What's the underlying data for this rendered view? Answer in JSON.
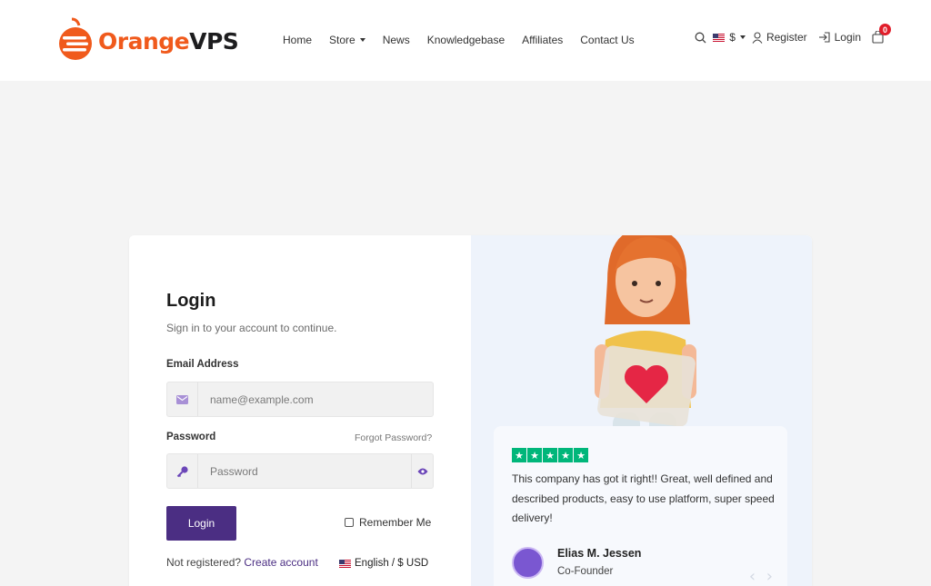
{
  "brand": {
    "name_orange": "Orange",
    "name_dark": "VPS",
    "accent": "#f05a1c",
    "primary": "#4b2e83"
  },
  "nav": {
    "items": [
      {
        "label": "Home"
      },
      {
        "label": "Store"
      },
      {
        "label": "News"
      },
      {
        "label": "Knowledgebase"
      },
      {
        "label": "Affiliates"
      },
      {
        "label": "Contact Us"
      }
    ]
  },
  "header_right": {
    "currency": "$",
    "register": "Register",
    "login": "Login",
    "cart_count": "0"
  },
  "login_form": {
    "title": "Login",
    "subtitle": "Sign in to your account to continue.",
    "email_label": "Email Address",
    "email_placeholder": "name@example.com",
    "password_label": "Password",
    "password_placeholder": "Password",
    "forgot": "Forgot Password?",
    "submit": "Login",
    "remember": "Remember Me",
    "not_registered": "Not registered?",
    "create_account": "Create account",
    "language": "English / $ USD"
  },
  "testimonial": {
    "rating": 5,
    "quote": "This company has got it right!! Great, well defined and described products, easy to use platform, super speed delivery!",
    "name": "Elias M. Jessen",
    "role": "Co-Founder"
  }
}
